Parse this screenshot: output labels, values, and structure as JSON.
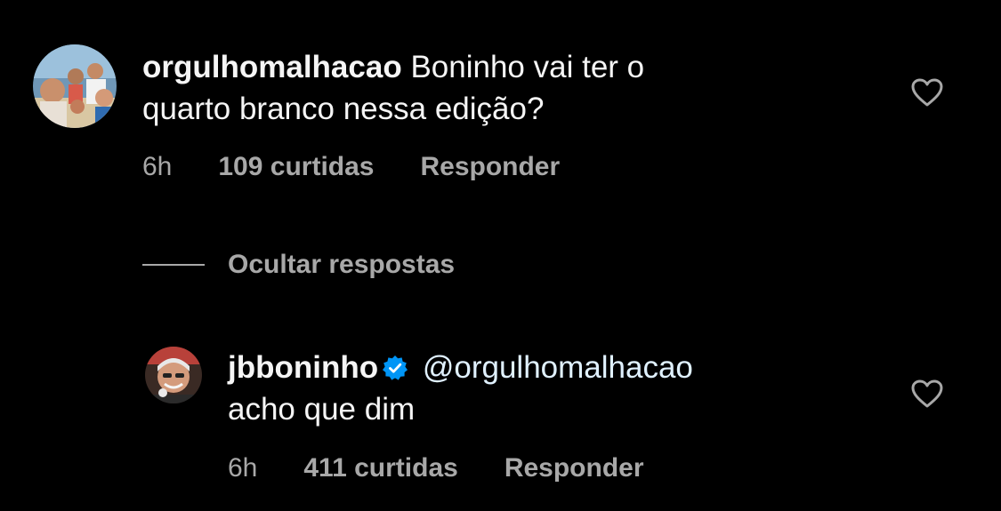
{
  "comments": [
    {
      "username": "orgulhomalhacao",
      "text_line1": "Boninho vai ter o",
      "text_line2": "quarto branco nessa edição?",
      "time": "6h",
      "likes": "109 curtidas",
      "reply_label": "Responder"
    }
  ],
  "hide_replies_label": "Ocultar respostas",
  "replies": [
    {
      "username": "jbboninho",
      "verified": true,
      "mention": "@orgulhomalhacao",
      "text": "acho que dim",
      "time": "6h",
      "likes": "411 curtidas",
      "reply_label": "Responder"
    }
  ],
  "icons": {
    "like": "heart-outline-icon",
    "verified": "verified-badge-icon"
  },
  "colors": {
    "background": "#000000",
    "primary_text": "#f5f5f5",
    "secondary_text": "#a8a8a8",
    "verified_blue": "#0095f6"
  }
}
